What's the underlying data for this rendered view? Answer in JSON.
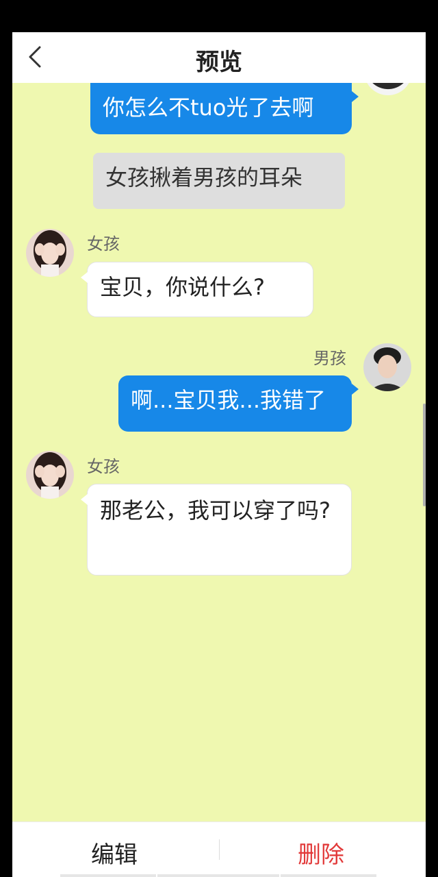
{
  "header": {
    "title": "预览",
    "back_icon": "chevron-left-icon"
  },
  "messages": [
    {
      "type": "outgoing",
      "text": "你怎么不tuo光了去啊"
    },
    {
      "type": "narration",
      "text": "女孩揪着男孩的耳朵"
    },
    {
      "type": "incoming",
      "sender": "女孩",
      "text": "宝贝，你说什么?"
    },
    {
      "type": "outgoing",
      "sender": "男孩",
      "text": "啊...宝贝我...我错了"
    },
    {
      "type": "incoming",
      "sender": "女孩",
      "text": "那老公，我可以穿了吗?"
    }
  ],
  "bottom": {
    "edit": "编辑",
    "delete": "删除"
  },
  "colors": {
    "chat_background": "#eff8b0",
    "outgoing_bubble": "#1788e8",
    "incoming_bubble": "#ffffff",
    "narration_bubble": "#dedede",
    "delete_text": "#e23a3a"
  }
}
